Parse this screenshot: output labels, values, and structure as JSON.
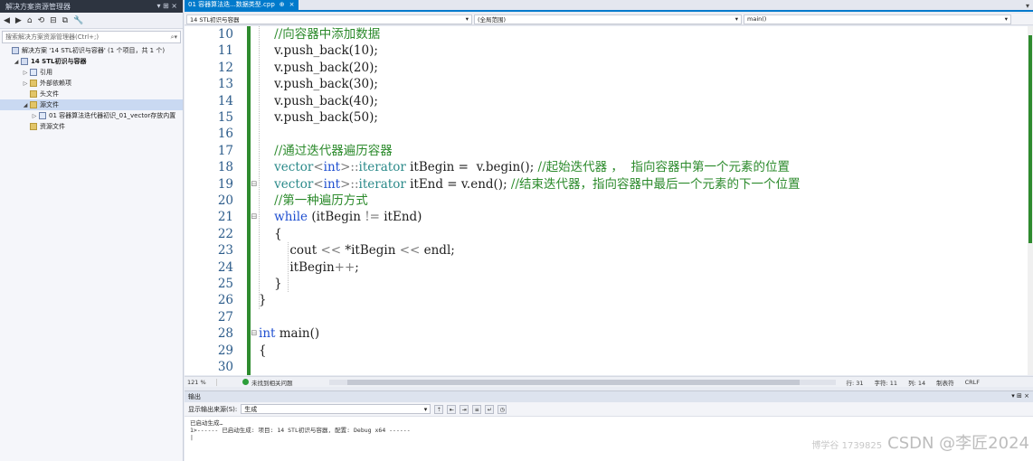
{
  "solution_explorer": {
    "title": "解决方案资源管理器",
    "search_placeholder": "搜索解决方案资源管理器(Ctrl+;)",
    "items": [
      {
        "label": "解决方案 '14 STL初识与容器' (1 个项目，共 1 个)",
        "level": 0
      },
      {
        "label": "14 STL初识与容器",
        "level": 1
      },
      {
        "label": "引用",
        "level": 2
      },
      {
        "label": "外部依赖项",
        "level": 2
      },
      {
        "label": "头文件",
        "level": 2
      },
      {
        "label": "源文件",
        "level": 2
      },
      {
        "label": "01 容器算法迭代器初识_01_vector存放内置",
        "level": 3
      },
      {
        "label": "资源文件",
        "level": 2
      }
    ]
  },
  "editor": {
    "tab_label": "01 容器算法迭...数据类型.cpp",
    "tab_pin": "⊕",
    "tab_close": "×",
    "nav_project": "14 STL初识与容器",
    "nav_scope": "(全局范围)",
    "nav_function": "main()",
    "lines": [
      {
        "n": "10",
        "text": "    //向容器中添加数据"
      },
      {
        "n": "11",
        "text": "    v.push_back(10);"
      },
      {
        "n": "12",
        "text": "    v.push_back(20);"
      },
      {
        "n": "13",
        "text": "    v.push_back(30);"
      },
      {
        "n": "14",
        "text": "    v.push_back(40);"
      },
      {
        "n": "15",
        "text": "    v.push_back(50);"
      },
      {
        "n": "16",
        "text": ""
      },
      {
        "n": "17",
        "text": "    //通过迭代器遍历容器"
      },
      {
        "n": "18",
        "text": "    vector<int>::iterator itBegin =  v.begin(); //起始迭代器 ，  指向容器中第一个元素的位置"
      },
      {
        "n": "19",
        "text": "    vector<int>::iterator itEnd = v.end(); //结束迭代器，指向容器中最后一个元素的下一个位置"
      },
      {
        "n": "20",
        "text": "    //第一种遍历方式"
      },
      {
        "n": "21",
        "text": "    while (itBegin != itEnd)"
      },
      {
        "n": "22",
        "text": "    {"
      },
      {
        "n": "23",
        "text": "        cout << *itBegin << endl;"
      },
      {
        "n": "24",
        "text": "        itBegin++;"
      },
      {
        "n": "25",
        "text": "    }"
      },
      {
        "n": "26",
        "text": "}"
      },
      {
        "n": "27",
        "text": ""
      },
      {
        "n": "28",
        "text": "int main()"
      },
      {
        "n": "29",
        "text": "{"
      },
      {
        "n": "30",
        "text": ""
      }
    ]
  },
  "status": {
    "zoom": "121 %",
    "issues": "未找到相关问题",
    "row": "行: 31",
    "char": "字符: 11",
    "col": "列: 14",
    "tabs": "制表符",
    "eol": "CRLF"
  },
  "output": {
    "title": "输出",
    "source_label": "显示输出来源(S):",
    "source_value": "生成",
    "lines": [
      "已启动生成…",
      "1>------ 已启动生成: 项目: 14 STL初识与容器, 配置: Debug x64 ------",
      "|"
    ]
  },
  "watermark": {
    "small": "博学谷 1739825",
    "large": "CSDN @李匠2024"
  }
}
